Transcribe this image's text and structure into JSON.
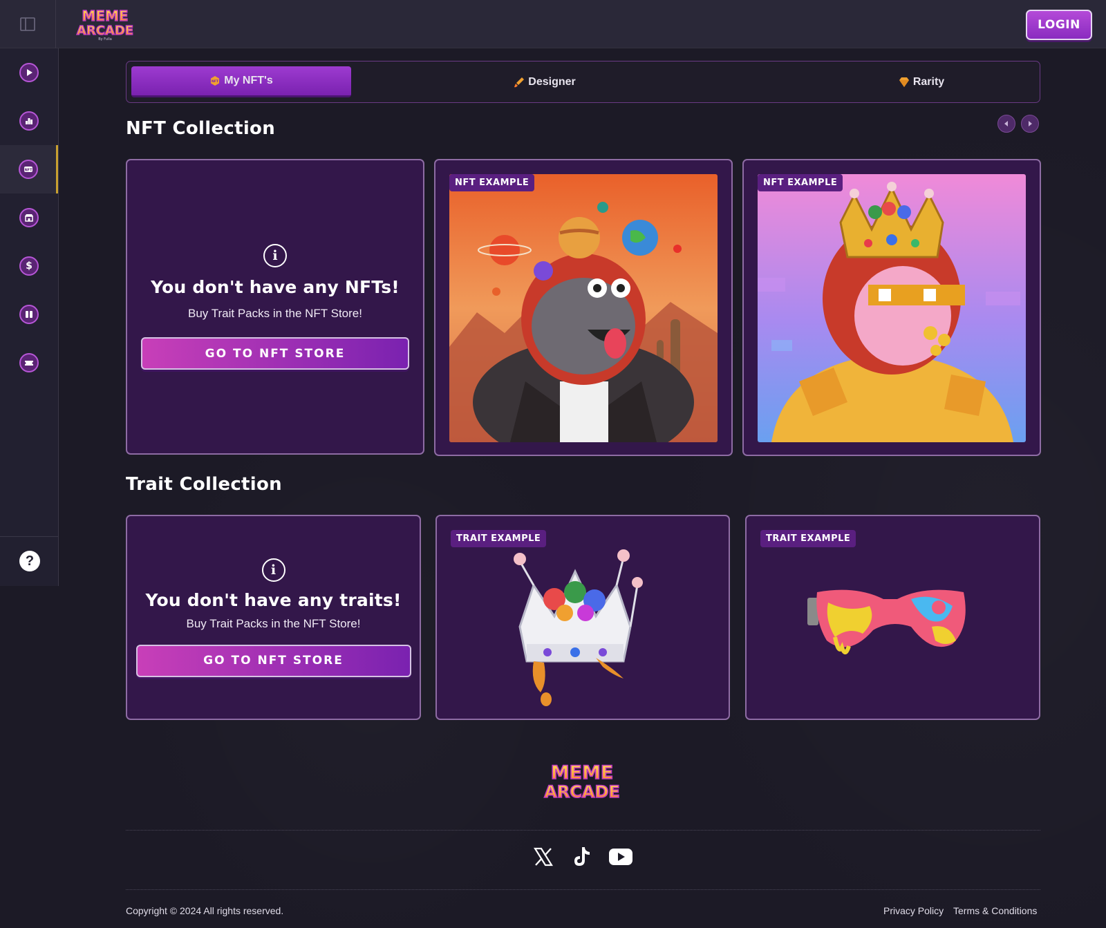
{
  "header": {
    "logo_line1": "MEME",
    "logo_line2": "ARCADE",
    "logo_tag": "By Fulla",
    "login_label": "LOGIN"
  },
  "sidebar": {
    "items": [
      {
        "icon": "play-icon",
        "active": false
      },
      {
        "icon": "leaderboard-icon",
        "active": false
      },
      {
        "icon": "nft-icon",
        "active": true
      },
      {
        "icon": "store-icon",
        "active": false
      },
      {
        "icon": "dollar-icon",
        "active": false
      },
      {
        "icon": "wallet-icon",
        "active": false
      },
      {
        "icon": "ticket-icon",
        "active": false
      }
    ],
    "help_label": "?"
  },
  "tabs": [
    {
      "label": "My NFT's",
      "icon": "nft-badge-icon",
      "active": true
    },
    {
      "label": "Designer",
      "icon": "brush-icon",
      "active": false
    },
    {
      "label": "Rarity",
      "icon": "diamond-icon",
      "active": false
    }
  ],
  "nft_section": {
    "title": "NFT Collection",
    "empty_title": "You don't have any NFTs!",
    "empty_sub": "Buy Trait Packs in the NFT Store!",
    "button_label": "GO TO NFT STORE",
    "examples": [
      {
        "badge": "NFT EXAMPLE"
      },
      {
        "badge": "NFT EXAMPLE"
      }
    ]
  },
  "trait_section": {
    "title": "Trait Collection",
    "empty_title": "You don't have any traits!",
    "empty_sub": "Buy Trait Packs in the NFT Store!",
    "button_label": "GO TO NFT STORE",
    "examples": [
      {
        "badge": "TRAIT EXAMPLE"
      },
      {
        "badge": "TRAIT EXAMPLE"
      }
    ]
  },
  "footer": {
    "logo_line1": "MEME",
    "logo_line2": "ARCADE",
    "socials": [
      "x-icon",
      "tiktok-icon",
      "youtube-icon"
    ],
    "copyright": "Copyright © 2024 All rights reserved.",
    "privacy": "Privacy Policy",
    "terms": "Terms & Conditions"
  },
  "colors": {
    "accent": "#9d3bd0",
    "card_bg": "#33174a",
    "page_bg": "#1c1a26"
  }
}
